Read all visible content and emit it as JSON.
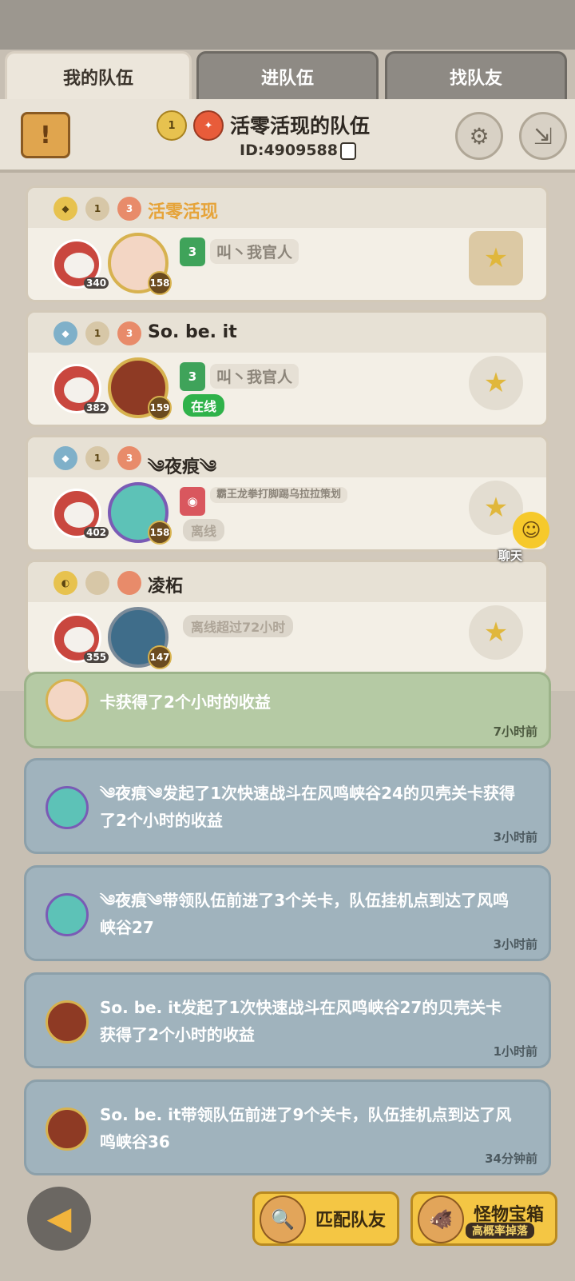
{
  "tabs": [
    {
      "label": "我的队伍",
      "active": true
    },
    {
      "label": "进队伍",
      "active": false
    },
    {
      "label": "找队友",
      "active": false
    }
  ],
  "header": {
    "team_name": "活零活现的队伍",
    "team_id": "ID:4909588",
    "badge_rank": "1",
    "icons": [
      "scroll-icon",
      "gear-icon",
      "exit-icon"
    ]
  },
  "members": [
    {
      "name": "活零活现",
      "name_color": "#e6a43a",
      "pet_level": "340",
      "hero_level": "158",
      "title_badge": "3",
      "title": "叫丶我官人",
      "status": "",
      "rank1": "1",
      "rank2": "3",
      "action": "like"
    },
    {
      "name": "So. be. it",
      "name_color": "#2e2822",
      "pet_level": "382",
      "hero_level": "159",
      "title_badge": "3",
      "title": "叫丶我官人",
      "status": "在线",
      "rank1": "1",
      "rank2": "3",
      "action": "like"
    },
    {
      "name": "༄夜痕༄",
      "name_color": "#2e2822",
      "pet_level": "402",
      "hero_level": "158",
      "title_badge": "",
      "title": "霸王龙拳打脚踢乌拉拉策划",
      "status": "离线",
      "rank1": "1",
      "rank2": "3",
      "action": "like"
    },
    {
      "name": "凌柘",
      "name_color": "#2e2822",
      "pet_level": "355",
      "hero_level": "147",
      "title_badge": "",
      "title": "",
      "status": "离线超过72小时",
      "rank1": "",
      "rank2": "",
      "action": "like"
    }
  ],
  "chat": {
    "label": "聊天"
  },
  "logs": [
    {
      "text": "卡获得了2个小时的收益",
      "time": "7小时前",
      "style": "green"
    },
    {
      "text": "༄夜痕༄发起了1次快速战斗在风鸣峡谷24的贝壳关卡获得了2个小时的收益",
      "time": "3小时前",
      "style": "blue"
    },
    {
      "text": "༄夜痕༄带领队伍前进了3个关卡，队伍挂机点到达了风鸣峡谷27",
      "time": "3小时前",
      "style": "blue"
    },
    {
      "text": "So. be. it发起了1次快速战斗在风鸣峡谷27的贝壳关卡获得了2个小时的收益",
      "time": "1小时前",
      "style": "blue"
    },
    {
      "text": "So. be. it带领队伍前进了9个关卡，队伍挂机点到达了风鸣峡谷36",
      "time": "34分钟前",
      "style": "blue"
    }
  ],
  "footer": {
    "match_label": "匹配队友",
    "monster_label": "怪物宝箱",
    "monster_sub": "高概率掉落"
  },
  "colors": {
    "accent_gold": "#f4c644",
    "online_green": "#2fb24a",
    "log_blue": "#a0b3bd",
    "log_green": "#b5caa4"
  }
}
